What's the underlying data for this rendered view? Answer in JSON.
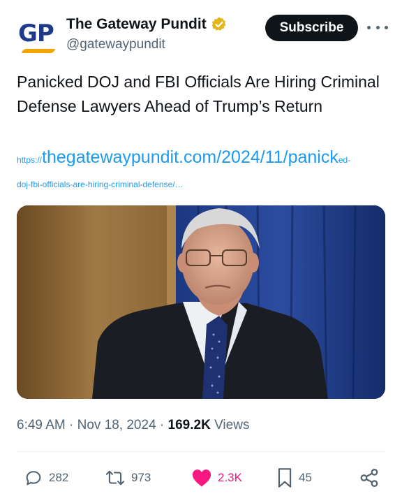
{
  "account": {
    "logo_text": "GP",
    "name": "The Gateway Pundit",
    "handle": "@gatewaypundit",
    "verified_badge_icon": "gold-verified-badge-icon"
  },
  "header": {
    "subscribe_label": "Subscribe",
    "more_icon": "more-horizontal-icon"
  },
  "tweet": {
    "text": "Panicked DOJ and FBI Officials Are Hiring Criminal Defense Lawyers Ahead of Trump’s Return",
    "link": {
      "prefix": "https://",
      "main": "thegatewaypundit.com/2024/11/panick",
      "suffix": "ed-",
      "line2": "doj-fbi-officials-are-hiring-criminal-defense/…"
    },
    "image_icon": "news-photo"
  },
  "meta": {
    "time": "6:49 AM",
    "sep1": " · ",
    "date": "Nov 18, 2024",
    "sep2": " · ",
    "views_count": "169.2K",
    "views_label": " Views"
  },
  "actions": {
    "replies": "282",
    "reposts": "973",
    "likes": "2.3K",
    "bookmarks": "45",
    "icons": [
      "reply-icon",
      "repost-icon",
      "like-icon",
      "bookmark-icon",
      "share-icon"
    ]
  },
  "colors": {
    "accent_link": "#1d9bf0",
    "like_pink": "#f91880",
    "text_primary": "#0f1419",
    "text_secondary": "#536471",
    "subscribe_bg": "#0f1419",
    "verified_gold": "#e2b719"
  }
}
